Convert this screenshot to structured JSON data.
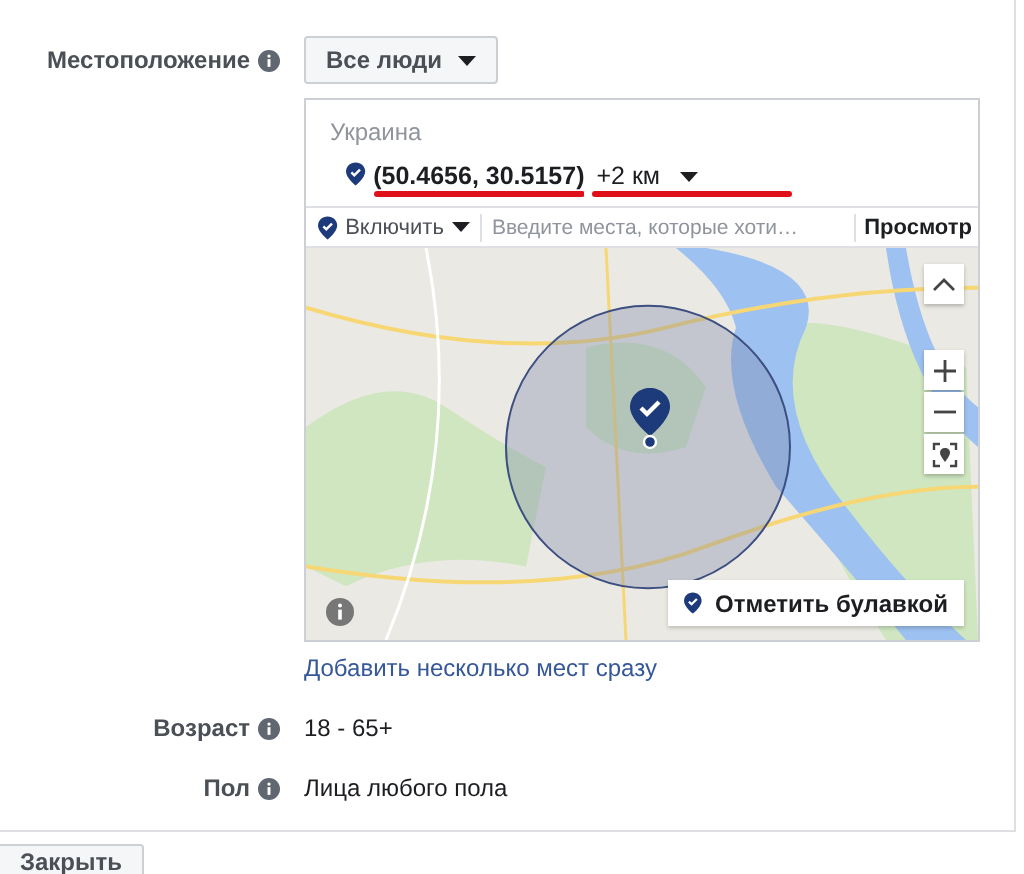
{
  "location": {
    "label": "Местоположение",
    "audience_dropdown": "Все люди",
    "country": "Украина",
    "pin": {
      "coordinates": "(50.4656, 30.5157)",
      "radius": "+2 км"
    },
    "toolbar": {
      "mode": "Включить",
      "search_placeholder": "Введите места, которые хоти…",
      "browse": "Просмотр"
    },
    "map": {
      "drop_pin_button": "Отметить булавкой"
    },
    "bulk_link": "Добавить несколько мест сразу"
  },
  "fields": [
    {
      "label": "Возраст",
      "value": "18 - 65+"
    },
    {
      "label": "Пол",
      "value": "Лица любого пола"
    }
  ],
  "close_button": "Закрыть"
}
